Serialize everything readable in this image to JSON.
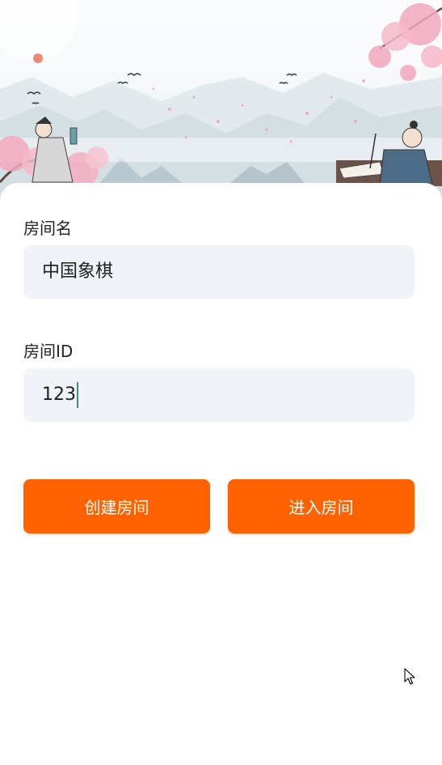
{
  "banner": {
    "image_description": "Chinese ink-wash landscape with misty mountains, cherry blossoms, flying birds and two scholars",
    "colors": {
      "sky": "#f3f6f8",
      "mountain": "#c9d6dc",
      "blossom": "#f2a7bd",
      "sun": "#ec8a72"
    }
  },
  "form": {
    "room_name": {
      "label": "房间名",
      "value": "中国象棋"
    },
    "room_id": {
      "label": "房间ID",
      "value": "123"
    }
  },
  "actions": {
    "create_label": "创建房间",
    "join_label": "进入房间",
    "button_color": "#ff6200"
  },
  "icons": {
    "cursor": "mouse-pointer-icon"
  }
}
